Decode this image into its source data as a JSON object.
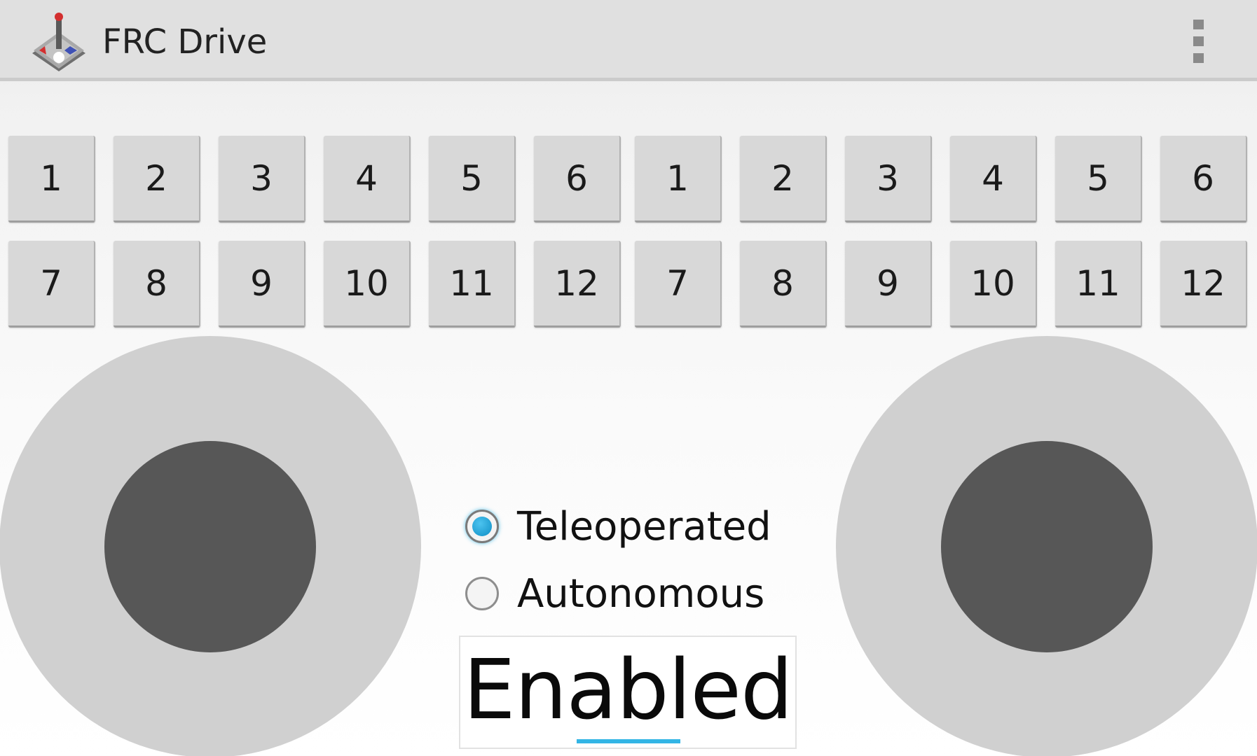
{
  "action_bar": {
    "title": "FRC Drive",
    "app_icon": "joystick-icon",
    "overflow_icon": "overflow-menu-icon"
  },
  "button_grid": {
    "left_group": [
      "1",
      "2",
      "3",
      "4",
      "5",
      "6",
      "7",
      "8",
      "9",
      "10",
      "11",
      "12"
    ],
    "right_group": [
      "1",
      "2",
      "3",
      "4",
      "5",
      "6",
      "7",
      "8",
      "9",
      "10",
      "11",
      "12"
    ]
  },
  "joysticks": {
    "left": {
      "base_color": "#d0d0d0",
      "knob_color": "#575757"
    },
    "right": {
      "base_color": "#d0d0d0",
      "knob_color": "#575757"
    }
  },
  "mode": {
    "options": [
      {
        "label": "Teleoperated",
        "checked": true
      },
      {
        "label": "Autonomous",
        "checked": false
      }
    ]
  },
  "enable_toggle": {
    "label": "Enabled",
    "accent_color": "#33b5e5"
  }
}
